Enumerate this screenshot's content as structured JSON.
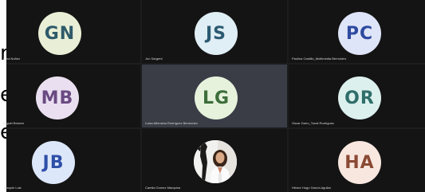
{
  "background_text": {
    "letters": [
      "n.",
      "e",
      "e"
    ]
  },
  "colors": {
    "gn_bg": "#e9efd6",
    "gn_fg": "#2e5a6a",
    "js_bg": "#e0eef5",
    "js_fg": "#2c5a72",
    "pc_bg": "#dfe5f8",
    "pc_fg": "#2e4aa0",
    "mb_bg": "#eadff0",
    "mb_fg": "#6a4a82",
    "lg_bg": "#e6f2dc",
    "lg_fg": "#3c6e3a",
    "or_bg": "#dcf0ee",
    "or_fg": "#2f6e6a",
    "jb_bg": "#dde7fa",
    "jb_fg": "#2d4fa8",
    "ha_bg": "#f8e7df",
    "ha_fg": "#8a4a34"
  },
  "participants": [
    {
      "initials": "GN",
      "name": "Gina Nuñez",
      "state": "avatar"
    },
    {
      "initials": "JS",
      "name": "Jon Sargent",
      "state": "avatar"
    },
    {
      "initials": "PC",
      "name": "Paulina Castillo_Multimedia Bermúdez",
      "state": "avatar"
    },
    {
      "initials": "MB",
      "name": "Miguel Briones",
      "state": "avatar"
    },
    {
      "initials": "LG",
      "name": "Luisa Alfonsina Rodríguez Bermúdez",
      "state": "avatar-active"
    },
    {
      "initials": "OR",
      "name": "Oscar Darío_Tonal Rodríguez",
      "state": "avatar"
    },
    {
      "initials": "JB",
      "name": "Joaquín Luis",
      "state": "avatar"
    },
    {
      "initials": "",
      "name": "Camila Gomez Marquina",
      "state": "video"
    },
    {
      "initials": "HA",
      "name": "Héctor Hugo García Aguilar",
      "state": "avatar"
    }
  ]
}
